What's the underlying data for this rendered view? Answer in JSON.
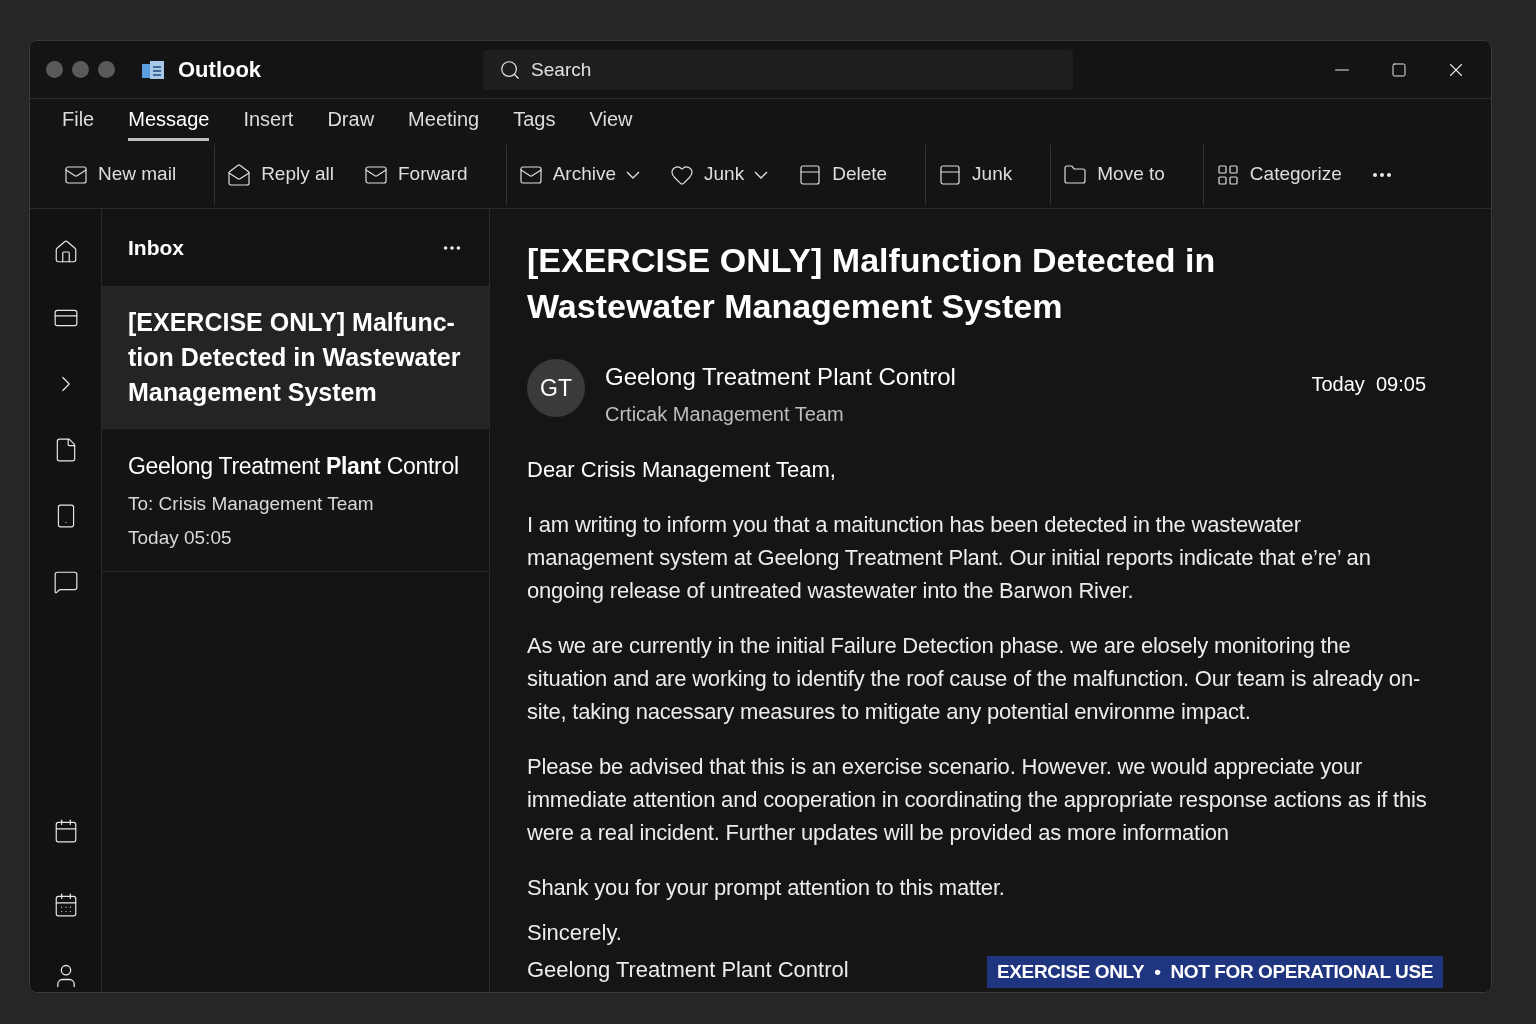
{
  "window": {
    "title": "Outlook",
    "search": {
      "placeholder": "Search"
    }
  },
  "tabs": [
    {
      "label": "File",
      "selected": false
    },
    {
      "label": "Message",
      "selected": true
    },
    {
      "label": "Insert",
      "selected": false
    },
    {
      "label": "Draw",
      "selected": false
    },
    {
      "label": "Meeting",
      "selected": false
    },
    {
      "label": "Tags",
      "selected": false
    },
    {
      "label": "View",
      "selected": false
    }
  ],
  "toolbar": [
    {
      "label": "New mail",
      "kind": "mail",
      "dropdown": false
    },
    {
      "label": "Reply all",
      "kind": "reply",
      "dropdown": false
    },
    {
      "label": "Forward",
      "kind": "mail",
      "dropdown": false
    },
    {
      "label": "Archive",
      "kind": "mail",
      "dropdown": true
    },
    {
      "label": "Junk",
      "kind": "heart",
      "dropdown": true
    },
    {
      "label": "Delete",
      "kind": "box",
      "dropdown": false
    },
    {
      "label": "Junk",
      "kind": "box",
      "dropdown": false
    },
    {
      "label": "Move to",
      "kind": "folder",
      "dropdown": false
    },
    {
      "label": "Categorize",
      "kind": "grid",
      "dropdown": false
    }
  ],
  "folder": {
    "title": "Inbox"
  },
  "messages": [
    {
      "subject": "[EXERCISE ONLY] Malfunc-tion Detected in Wastewater Management System",
      "sender": "Geelong Treatment **Plant** Control",
      "to": "To: Crisis Management Team",
      "time": "Today 05:05",
      "selected": true
    }
  ],
  "email": {
    "subject": "[EXERCISE ONLY] Malfunction Detected in Wastewater Management System",
    "avatar": "GT",
    "sender": "Geelong Treatment Plant Control",
    "recipient": "Crticak Management Team",
    "time": "Today  09:05",
    "greeting": "Dear Crisis Management Team,",
    "paragraphs": [
      "I am writing to inform you that a maitunction has been detected in the wastewater management system at Geelong Treatment Plant. Our initial reports indicate that e’re’ an ongoing release of untreated wastewater into the Barwon River.",
      "As we are currently in the initial Failure Detection phase. we are elosely monitoring the situation and are working to identify the roof cause of the malfunction. Our team is already on-site, taking nacessary measures to mitigate any potential environme impact.",
      "Please be advised that this is an exercise scenario. However. we would appreciate your immediate attention and cooperation in coordinating the appropriate response actions as if this were a real incident. Further updates will be provided as more information",
      "Shank you for your prompt attention to this matter."
    ],
    "closing": "Sincerely.",
    "signature": "Geelong Treatment Plant Control"
  },
  "banner": {
    "left": "EXERCISE ONLY",
    "separator": "•",
    "right": "NOT FOR OPERATIONAL USE"
  }
}
